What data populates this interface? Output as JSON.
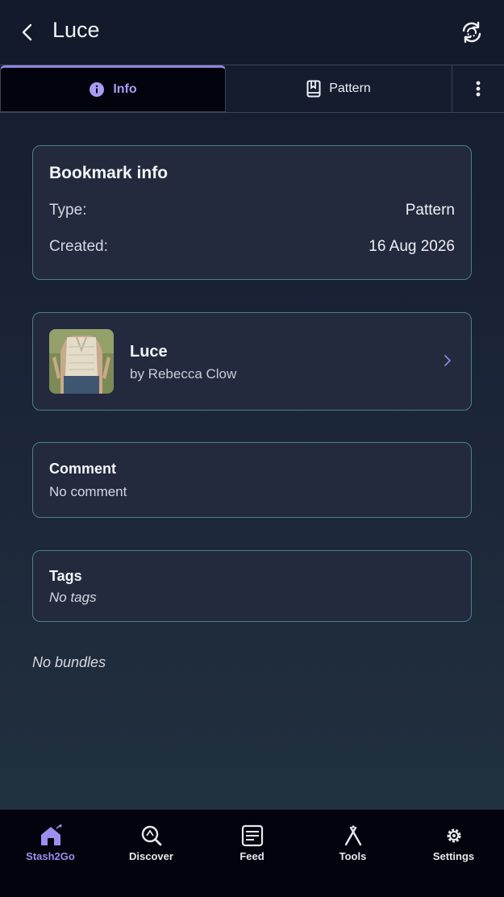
{
  "header": {
    "title": "Luce",
    "back_icon": "chevron-left-icon",
    "sync_icon": "sync-icon"
  },
  "tabs": [
    {
      "label": "Info",
      "icon": "info-icon",
      "active": true
    },
    {
      "label": "Pattern",
      "icon": "book-icon",
      "active": false
    },
    {
      "label": "",
      "icon": "more-vertical-icon",
      "active": false
    }
  ],
  "bookmark_info": {
    "title": "Bookmark info",
    "rows": [
      {
        "label": "Type:",
        "value": "Pattern"
      },
      {
        "label": "Created:",
        "value": "16 Aug 2026"
      }
    ]
  },
  "pattern": {
    "name": "Luce",
    "author": "by Rebecca Clow",
    "thumb_icon": "pattern-photo"
  },
  "comment": {
    "title": "Comment",
    "text": "No comment"
  },
  "tags": {
    "title": "Tags",
    "text": "No tags"
  },
  "bundles_text": "No bundles",
  "bottom_nav": [
    {
      "label": "Stash2Go",
      "icon": "home-icon",
      "active": true
    },
    {
      "label": "Discover",
      "icon": "discover-icon",
      "active": false
    },
    {
      "label": "Feed",
      "icon": "feed-icon",
      "active": false
    },
    {
      "label": "Tools",
      "icon": "tools-icon",
      "active": false
    },
    {
      "label": "Settings",
      "icon": "settings-icon",
      "active": false
    }
  ],
  "colors": {
    "accent": "#9d8ff0",
    "card_border": "#4f7f86",
    "card_bg": "#232a3e"
  }
}
